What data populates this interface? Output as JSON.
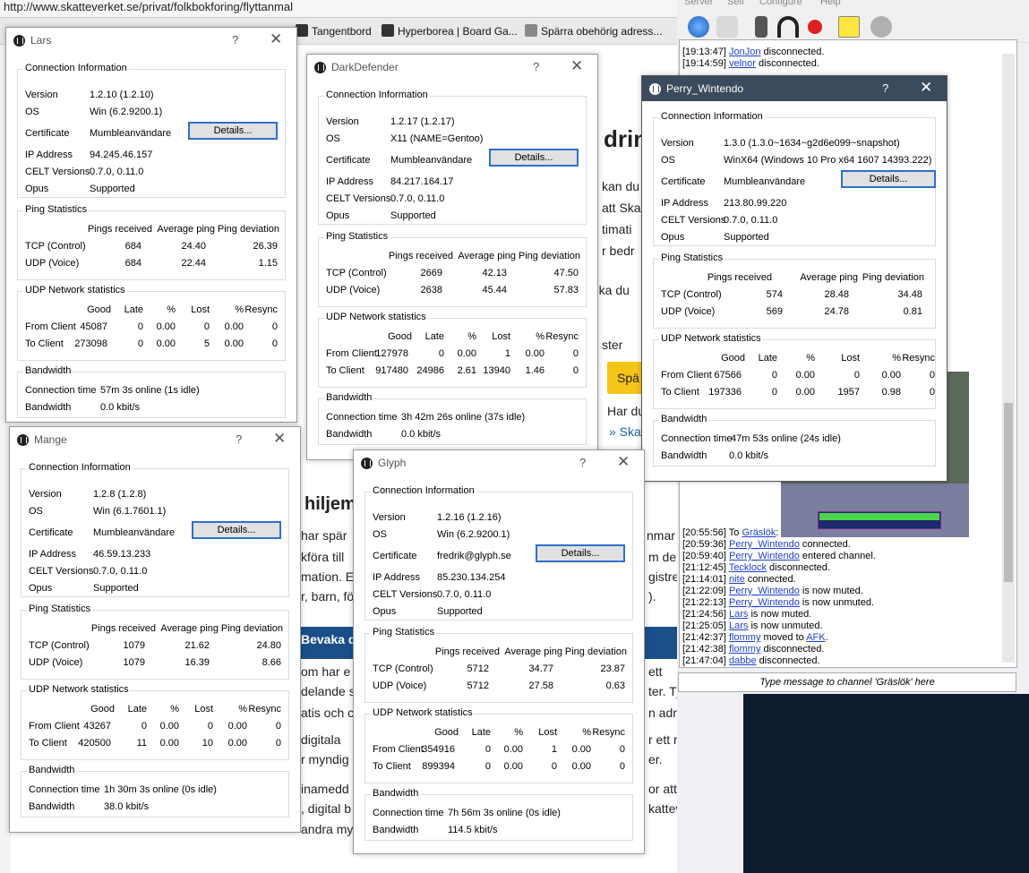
{
  "browser": {
    "url": "http://www.skatteverket.se/privat/folkbokforing/flyttanmal",
    "bookmarks": [
      "Tangentbord",
      "Hyperborea | Board Ga...",
      "Spärra obehörig adress..."
    ],
    "page": {
      "heading": "drin",
      "body_lines": [
        "kan du",
        "att Ska",
        "timati",
        "r bedr",
        "g ska du",
        "ster",
        "Har du",
        "» Skat",
        "hiljem",
        "har spär",
        "kföra till",
        "mation. E",
        "r, barn, fö",
        "nmar",
        "m de",
        "gistrer",
        ").",
        "om har e",
        "delande s",
        "atis och c",
        "digitala ",
        "r myndig",
        "inamedd",
        ", digital b",
        "ett",
        "ter. Tjänsten",
        "n adress.",
        "r ett mejl när",
        "er.",
        "or att få en",
        "katteverket",
        "andra my"
      ],
      "banner": "Bevaka d",
      "button": "Spä"
    }
  },
  "mumble": {
    "menu": [
      "Server",
      "Self",
      "Configure",
      "Help"
    ],
    "chat": [
      {
        "time": "[19:13:47]",
        "user": "JonJon",
        "text": " disconnected."
      },
      {
        "time": "[19:14:59]",
        "user": "velnor",
        "text": " disconnected."
      },
      {
        "time": "[20:55:56]",
        "prefix": " To ",
        "user": "Gräslök",
        "text": ":"
      },
      {
        "time": "[20:59:36]",
        "user": "Perry_Wintendo",
        "text": " connected."
      },
      {
        "time": "[20:59:40]",
        "user": "Perry_Wintendo",
        "text": " entered channel."
      },
      {
        "time": "[21:12:45]",
        "user": "Tecklock",
        "text": " disconnected."
      },
      {
        "time": "[21:14:01]",
        "user": "nite",
        "text": " connected."
      },
      {
        "time": "[21:22:09]",
        "user": "Perry_Wintendo",
        "text": " is now muted."
      },
      {
        "time": "[21:22:13]",
        "user": "Perry_Wintendo",
        "text": " is now unmuted."
      },
      {
        "time": "[21:24:56]",
        "user": "Lars",
        "text": " is now muted."
      },
      {
        "time": "[21:25:05]",
        "user": "Lars",
        "text": " is now unmuted."
      },
      {
        "time": "[21:42:37]",
        "user": "flommy",
        "text": " moved to ",
        "target": "AFK",
        "after": "."
      },
      {
        "time": "[21:42:38]",
        "user": "flommy",
        "text": " disconnected."
      },
      {
        "time": "[21:47:04]",
        "user": "dabbe",
        "text": " disconnected."
      }
    ],
    "chat_placeholder": "Type message to channel 'Gräslök' here"
  },
  "labels": {
    "conn_info": "Connection Information",
    "version": "Version",
    "os": "OS",
    "certificate": "Certificate",
    "details": "Details...",
    "ip": "IP Address",
    "celt": "CELT Versions",
    "opus": "Opus",
    "ping_stats": "Ping Statistics",
    "pings_received": "Pings received",
    "avg_ping": "Average ping",
    "ping_dev": "Ping deviation",
    "tcp": "TCP (Control)",
    "udp": "UDP (Voice)",
    "udp_net": "UDP Network statistics",
    "good": "Good",
    "late": "Late",
    "pct": "%",
    "lost": "Lost",
    "resync": "Resync",
    "from_client": "From Client",
    "to_client": "To Client",
    "bandwidth_group": "Bandwidth",
    "conn_time": "Connection time",
    "bandwidth": "Bandwidth",
    "help": "?",
    "close": "✕"
  },
  "dialogs": [
    {
      "id": "lars",
      "title": "Lars",
      "version": "1.2.10 (1.2.10)",
      "os": "Win (6.2.9200.1)",
      "certificate": "Mumbleanvändare",
      "ip": "94.245.46.157",
      "celt": "0.7.0, 0.11.0",
      "opus": "Supported",
      "tcp": [
        "684",
        "24.40",
        "26.39"
      ],
      "udp": [
        "684",
        "22.44",
        "1.15"
      ],
      "from": [
        "45087",
        "0",
        "0.00",
        "0",
        "0.00",
        "0"
      ],
      "to": [
        "273098",
        "0",
        "0.00",
        "5",
        "0.00",
        "0"
      ],
      "conn_time": "57m 3s online (1s idle)",
      "bandwidth": "0.0 kbit/s"
    },
    {
      "id": "darkdefender",
      "title": "DarkDefender",
      "version": "1.2.17 (1.2.17)",
      "os": "X11 (NAME=Gentoo)",
      "certificate": "Mumbleanvändare",
      "ip": "84.217.164.17",
      "celt": "0.7.0, 0.11.0",
      "opus": "Supported",
      "tcp": [
        "2669",
        "42.13",
        "47.50"
      ],
      "udp": [
        "2638",
        "45.44",
        "57.83"
      ],
      "from": [
        "127978",
        "0",
        "0.00",
        "1",
        "0.00",
        "0"
      ],
      "to": [
        "917480",
        "24986",
        "2.61",
        "13940",
        "1.46",
        "0"
      ],
      "conn_time": "3h 42m 26s online (37s idle)",
      "bandwidth": "0.0 kbit/s"
    },
    {
      "id": "perry",
      "title": "Perry_Wintendo",
      "version": "1.3.0 (1.3.0~1634~g2d6e099~snapshot)",
      "os": "WinX64 (Windows 10 Pro x64 1607 14393.222)",
      "certificate": "Mumbleanvändare",
      "ip": "213.80.99.220",
      "celt": "0.7.0, 0.11.0",
      "opus": "Supported",
      "tcp": [
        "574",
        "28.48",
        "34.48"
      ],
      "udp": [
        "569",
        "24.78",
        "0.81"
      ],
      "from": [
        "67566",
        "0",
        "0.00",
        "0",
        "0.00",
        "0"
      ],
      "to": [
        "197336",
        "0",
        "0.00",
        "1957",
        "0.98",
        "0"
      ],
      "conn_time": "47m 53s online (24s idle)",
      "bandwidth": "0.0 kbit/s"
    },
    {
      "id": "mange",
      "title": "Mange",
      "version": "1.2.8 (1.2.8)",
      "os": "Win (6.1.7601.1)",
      "certificate": "Mumbleanvändare",
      "ip": "46.59.13.233",
      "celt": "0.7.0, 0.11.0",
      "opus": "Supported",
      "tcp": [
        "1079",
        "21.62",
        "24.80"
      ],
      "udp": [
        "1079",
        "16.39",
        "8.66"
      ],
      "from": [
        "43267",
        "0",
        "0.00",
        "0",
        "0.00",
        "0"
      ],
      "to": [
        "420500",
        "11",
        "0.00",
        "10",
        "0.00",
        "0"
      ],
      "conn_time": "1h 30m 3s online (0s idle)",
      "bandwidth": "38.0 kbit/s"
    },
    {
      "id": "glyph",
      "title": "Glyph",
      "version": "1.2.16 (1.2.16)",
      "os": "Win (6.2.9200.1)",
      "certificate": "fredrik@glyph.se",
      "ip": "85.230.134.254",
      "celt": "0.7.0, 0.11.0",
      "opus": "Supported",
      "tcp": [
        "5712",
        "34.77",
        "23.87"
      ],
      "udp": [
        "5712",
        "27.58",
        "0.63"
      ],
      "from": [
        "354916",
        "0",
        "0.00",
        "1",
        "0.00",
        "0"
      ],
      "to": [
        "899394",
        "0",
        "0.00",
        "0",
        "0.00",
        "0"
      ],
      "conn_time": "7h 56m 3s online (0s idle)",
      "bandwidth": "114.5 kbit/s"
    }
  ]
}
